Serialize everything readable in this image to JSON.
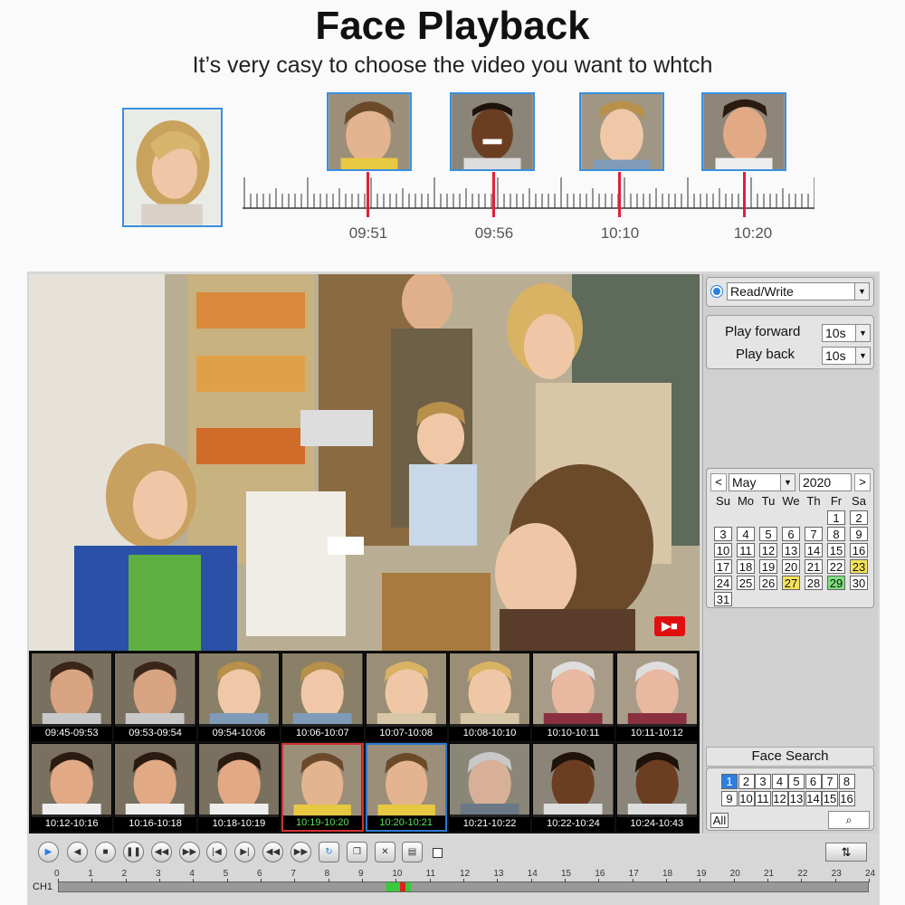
{
  "hero": {
    "title": "Face Playback",
    "subtitle": "It’s very casy to choose the video you want to whtch"
  },
  "timeline_labels": [
    "09:51",
    "09:56",
    "10:10",
    "10:20"
  ],
  "panel": {
    "mode_select": "Read/Write",
    "play_forward_label": "Play forward",
    "play_forward_value": "10s",
    "play_back_label": "Play back",
    "play_back_value": "10s",
    "calendar": {
      "prev": "<",
      "next": ">",
      "month": "May",
      "year": "2020",
      "weekdays": [
        "Su",
        "Mo",
        "Tu",
        "We",
        "Th",
        "Fr",
        "Sa"
      ],
      "days": [
        "",
        "",
        "",
        "",
        "",
        "1",
        "2",
        "3",
        "4",
        "5",
        "6",
        "7",
        "8",
        "9",
        "10",
        "11",
        "12",
        "13",
        "14",
        "15",
        "16",
        "17",
        "18",
        "19",
        "20",
        "21",
        "22",
        "23",
        "24",
        "25",
        "26",
        "27",
        "28",
        "29",
        "30",
        "31"
      ],
      "highlight_yellow": [
        "23",
        "27"
      ],
      "highlight_green": [
        "29"
      ]
    },
    "face_search_label": "Face Search",
    "channels": [
      "1",
      "2",
      "3",
      "4",
      "5",
      "6",
      "7",
      "8",
      "9",
      "10",
      "11",
      "12",
      "13",
      "14",
      "15",
      "16"
    ],
    "active_channel": "1",
    "all_label": "All"
  },
  "thumbnails": [
    {
      "label": "09:45-09:53",
      "style": "normal"
    },
    {
      "label": "09:53-09:54",
      "style": "normal"
    },
    {
      "label": "09:54-10:06",
      "style": "normal"
    },
    {
      "label": "10:06-10:07",
      "style": "normal"
    },
    {
      "label": "10:07-10:08",
      "style": "normal"
    },
    {
      "label": "10:08-10:10",
      "style": "normal"
    },
    {
      "label": "10:10-10:11",
      "style": "normal"
    },
    {
      "label": "10:11-10:12",
      "style": "normal"
    },
    {
      "label": "10:12-10:16",
      "style": "normal"
    },
    {
      "label": "10:16-10:18",
      "style": "normal"
    },
    {
      "label": "10:18-10:19",
      "style": "normal"
    },
    {
      "label": "10:19-10:20",
      "style": "red"
    },
    {
      "label": "10:20-10:21",
      "style": "blue"
    },
    {
      "label": "10:21-10:22",
      "style": "normal"
    },
    {
      "label": "10:22-10:24",
      "style": "normal"
    },
    {
      "label": "10:24-10:43",
      "style": "normal"
    }
  ],
  "timeline": {
    "channel_label": "CH1",
    "hours": [
      "0",
      "1",
      "2",
      "3",
      "4",
      "5",
      "6",
      "7",
      "8",
      "9",
      "10",
      "11",
      "12",
      "13",
      "14",
      "15",
      "16",
      "17",
      "18",
      "19",
      "20",
      "21",
      "22",
      "23",
      "24"
    ]
  },
  "colors": {
    "accent": "#2a7fe0",
    "record_marker": "#e01010",
    "highlight_yellow": "#f5e35a",
    "highlight_green": "#7de07d"
  }
}
